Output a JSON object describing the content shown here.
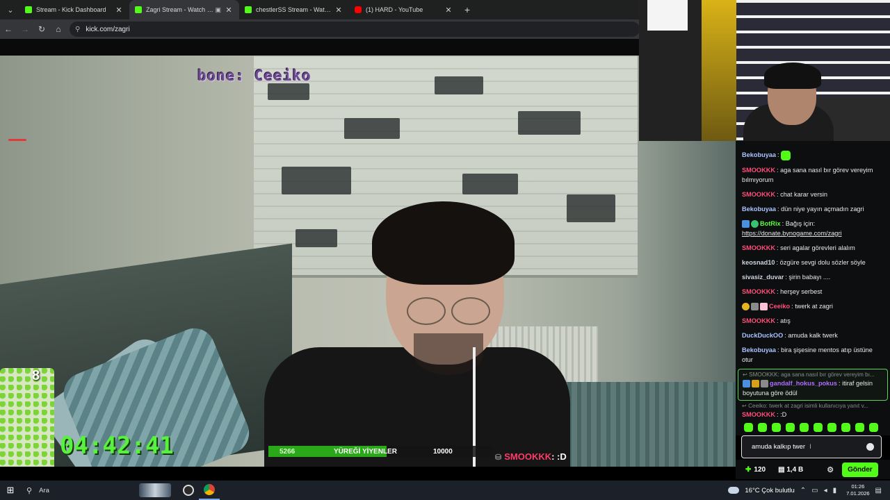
{
  "browser": {
    "tabs": [
      {
        "label": "Stream - Kick Dashboard",
        "favicon": "kick-icon",
        "active": false
      },
      {
        "label": "Zagri Stream - Watch Live on Kick",
        "favicon": "kick-icon",
        "active": true
      },
      {
        "label": "chestlerSS Stream - Watch Live on Kick",
        "favicon": "kick-icon",
        "active": false
      },
      {
        "label": "(1) HARD - YouTube",
        "favicon": "youtube-icon",
        "active": false
      }
    ],
    "url": "kick.com/zagri"
  },
  "stream_overlay": {
    "top_text": "bone: Ceeiko",
    "timer": "04:42:41",
    "sticker_count": "8",
    "goal": {
      "current": "5266",
      "title": "YÜREĞİ YİYENLER",
      "target": "10000",
      "progress": 0.5266
    },
    "last_chat": {
      "user": "SMOOKKK",
      "message": ": :D"
    }
  },
  "chat": {
    "messages": [
      {
        "user": "Bekobuyaa",
        "color": "u-blue",
        "text": "",
        "emote": true
      },
      {
        "user": "SMOOKKK",
        "color": "u-pink",
        "text": "aga sana nasıl bır görev vereyim bılmıyorum"
      },
      {
        "user": "SMOOKKK",
        "color": "u-pink",
        "text": "chat karar versin"
      },
      {
        "user": "Bekobuyaa",
        "color": "u-blue",
        "text": "dün niye yayın açmadın zagri"
      },
      {
        "user": "BotRix",
        "color": "u-green",
        "text": "Bağış için:",
        "link": "https://donate.bynogame.com/zagri",
        "badges": [
          "blue",
          "green"
        ]
      },
      {
        "user": "SMOOKKK",
        "color": "u-pink",
        "text": "seri agalar görevleri alalım"
      },
      {
        "user": "keosnad10",
        "color": "u-gray",
        "text": "özgüre sevgi dolu sözler söyle"
      },
      {
        "user": "sivasiz_duvar",
        "color": "u-gray",
        "text": "şirin babayı ...."
      },
      {
        "user": "SMOOKKK",
        "color": "u-pink",
        "text": "herşey serbest"
      },
      {
        "user": "Ceeiko",
        "color": "u-pink",
        "text": "twerk at zagri",
        "badges": [
          "yellow",
          "gray",
          "pink"
        ]
      },
      {
        "user": "SMOOKKK",
        "color": "u-pink",
        "text": "atış"
      },
      {
        "user": "DuckDuckOO",
        "color": "u-blue",
        "text": "amuda kalk twerk"
      },
      {
        "user": "Bekobuyaa",
        "color": "u-blue",
        "text": "bira şişesine mentos atıp üstüne otur"
      }
    ],
    "highlighted": {
      "reply_to": "SMOOKKK: aga sana nasıl bır görev vereyim bı...",
      "user": "gandalf_hokus_pokus",
      "text": "itiraf gelsin boyutuna göre ödül"
    },
    "last": {
      "reply_to": "Ceeiko: twerk at zagri isimli kullanıcıya yanıt v...",
      "user": "SMOOKKK",
      "text": ":D"
    },
    "input_value": "amuda kalkıp twer",
    "points": "120",
    "balance": "1,4 B",
    "send_label": "Gönder"
  },
  "taskbar": {
    "search_placeholder": "Ara",
    "weather": "16°C  Çok bulutlu",
    "time": "01:26",
    "date": "7.01.2026"
  },
  "colors": {
    "kick_green": "#53fc18",
    "chat_bg": "#0c0e0f",
    "taskbar_bg": "#1c2028"
  }
}
